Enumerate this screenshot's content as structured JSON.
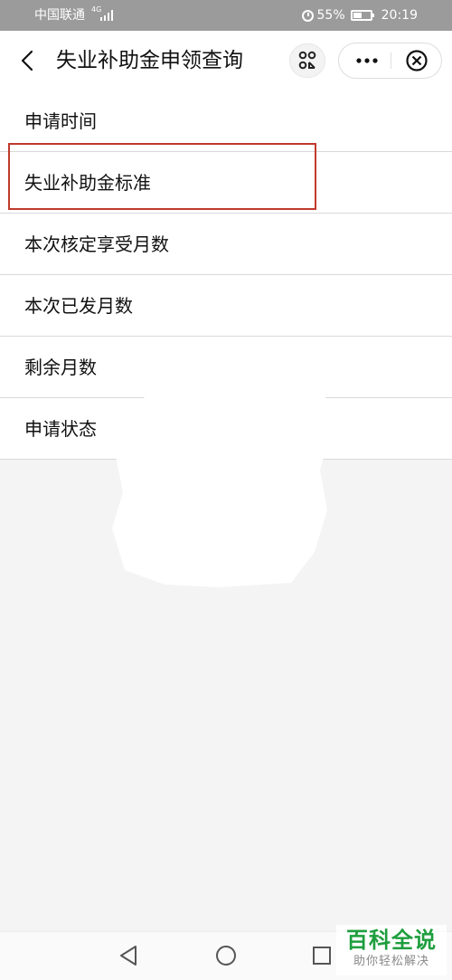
{
  "status_bar": {
    "carrier": "中国联通",
    "network": "4G",
    "battery": "55%",
    "time": "20:19"
  },
  "nav": {
    "back_icon": "chevron-left-icon",
    "title": "失业补助金申领查询",
    "scan_icon": "scan-icon",
    "more_icon": "more-icon",
    "close_icon": "close-circle-icon"
  },
  "list": {
    "items": [
      "申请时间",
      "失业补助金标准",
      "本次核定享受月数",
      "本次已发月数",
      "剩余月数",
      "申请状态"
    ],
    "highlighted_index": 1
  },
  "colors": {
    "status_bar": "#9b9b9b",
    "highlight": "#c0392b",
    "watermark": "#1e9e3e"
  },
  "watermark": {
    "title": "百科全说",
    "subtitle": "助你轻松解决"
  }
}
